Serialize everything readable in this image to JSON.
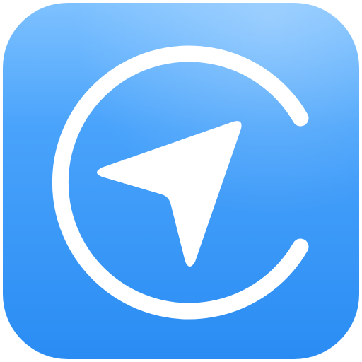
{
  "icon": {
    "name": "location-navigation-app-icon",
    "glyphs": [
      "c-ring-icon",
      "navigation-arrow-icon"
    ],
    "colors": {
      "background_top": "#7EC1FF",
      "background_mid": "#49A3FB",
      "background_bottom": "#2A8CF3",
      "glyph": "#FFFFFF"
    }
  }
}
